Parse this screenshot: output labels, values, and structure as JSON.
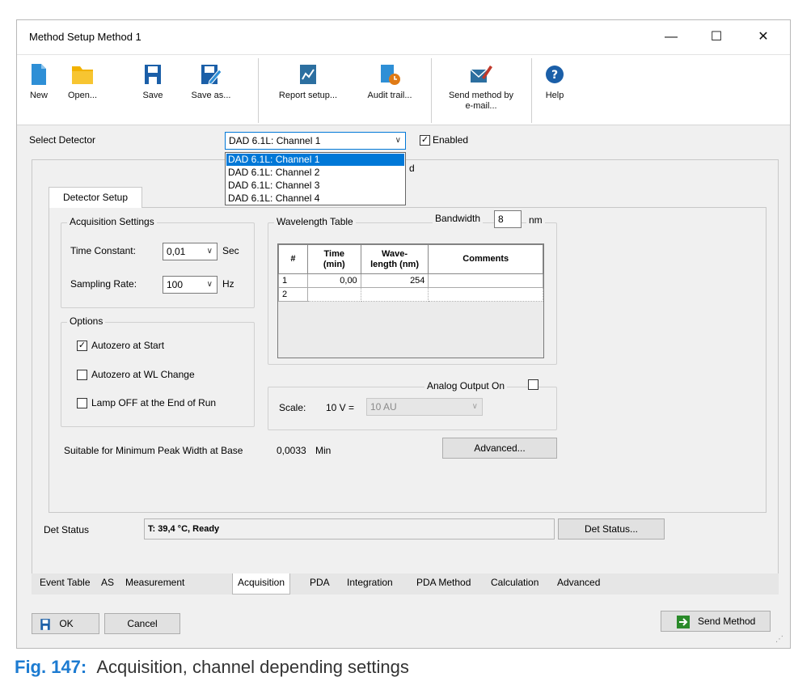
{
  "window": {
    "title": "Method Setup Method 1",
    "minimize": "—",
    "maximize": "☐",
    "close": "✕"
  },
  "toolbar": {
    "new": "New",
    "open": "Open...",
    "save": "Save",
    "save_as": "Save as...",
    "report_setup": "Report setup...",
    "audit_trail": "Audit trail...",
    "send_email_line1": "Send method by",
    "send_email_line2": "e-mail...",
    "help": "Help"
  },
  "detector": {
    "label": "Select Detector",
    "selected": "DAD 6.1L: Channel 1",
    "options": [
      "DAD 6.1L: Channel 1",
      "DAD 6.1L: Channel 2",
      "DAD 6.1L: Channel 3",
      "DAD 6.1L: Channel 4"
    ],
    "enabled_label": "Enabled",
    "enabled": true,
    "hidden_fragment": "d"
  },
  "detector_setup_tab": "Detector Setup",
  "acquisition": {
    "legend": "Acquisition Settings",
    "time_constant_label": "Time Constant:",
    "time_constant_value": "0,01",
    "time_constant_unit": "Sec",
    "sampling_rate_label": "Sampling Rate:",
    "sampling_rate_value": "100",
    "sampling_rate_unit": "Hz"
  },
  "options": {
    "legend": "Options",
    "autozero_start": "Autozero at Start",
    "autozero_start_checked": true,
    "autozero_wl": "Autozero at WL Change",
    "autozero_wl_checked": false,
    "lamp_off": "Lamp OFF at the End of Run",
    "lamp_off_checked": false
  },
  "wavelength": {
    "legend": "Wavelength Table",
    "bandwidth_label": "Bandwidth",
    "bandwidth_value": "8",
    "bandwidth_unit": "nm",
    "headers": {
      "num": "#",
      "time_1": "Time",
      "time_2": "(min)",
      "wave_1": "Wave-",
      "wave_2": "length (nm)",
      "comments": "Comments"
    },
    "rows": [
      {
        "num": "1",
        "time": "0,00",
        "wave": "254",
        "comments": ""
      },
      {
        "num": "2",
        "time": "",
        "wave": "",
        "comments": ""
      }
    ]
  },
  "analog": {
    "label": "Analog Output On",
    "checked": false,
    "scale_label": "Scale:",
    "scale_v": "10 V =",
    "scale_value": "10 AU"
  },
  "peak_width": {
    "label": "Suitable for Minimum Peak Width at Base",
    "value": "0,0033",
    "unit": "Min"
  },
  "advanced_button": "Advanced...",
  "status": {
    "label": "Det Status",
    "value": "T: 39,4 °C, Ready",
    "button": "Det Status..."
  },
  "bottom_tabs": [
    "Event Table",
    "AS",
    "Measurement",
    "Acquisition",
    "PDA",
    "Integration",
    "PDA Method",
    "Calculation",
    "Advanced"
  ],
  "active_tab": "Acquisition",
  "footer": {
    "ok": "OK",
    "cancel": "Cancel",
    "send_method": "Send Method"
  },
  "caption": {
    "fig": "Fig. 147:",
    "text": "Acquisition, channel depending settings"
  },
  "colors": {
    "accent_blue": "#1c7bd1",
    "icon_blue": "#2e8fd6",
    "icon_folder": "#f2b200",
    "selection": "#0078d7"
  }
}
